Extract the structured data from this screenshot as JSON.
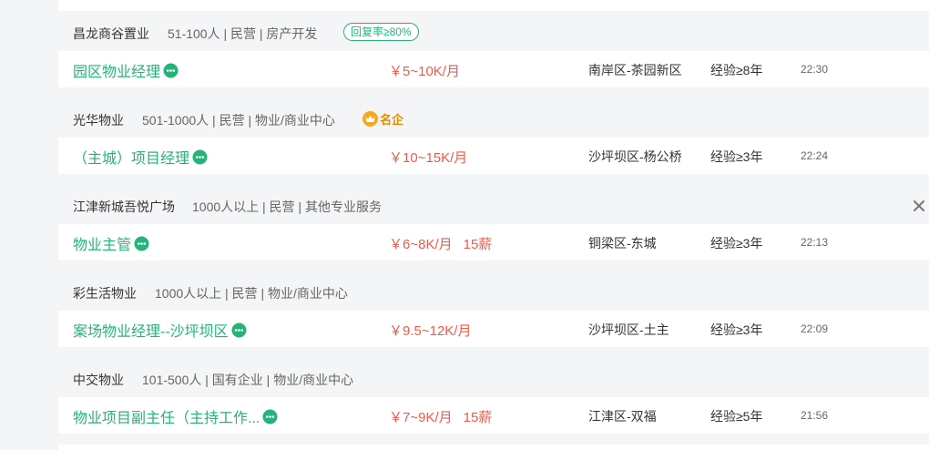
{
  "jobs": [
    {
      "company": "昌龙商谷置业",
      "info": "51-100人 | 民营 | 房产开发",
      "badge": "回复率≥80%",
      "title": "园区物业经理",
      "salary": "￥5~10K/月",
      "bonus": "",
      "location": "南岸区-茶园新区",
      "experience": "经验≥8年",
      "time": "22:30"
    },
    {
      "company": "光华物业",
      "info": "501-1000人 | 民营 | 物业/商业中心",
      "famous": "名企",
      "title": "（主城）项目经理",
      "salary": "￥10~15K/月",
      "bonus": "",
      "location": "沙坪坝区-杨公桥",
      "experience": "经验≥3年",
      "time": "22:24"
    },
    {
      "company": "江津新城吾悦广场",
      "info": "1000人以上 | 民营 | 其他专业服务",
      "title": "物业主管",
      "salary": "￥6~8K/月",
      "bonus": "15薪",
      "location": "铜梁区-东城",
      "experience": "经验≥3年",
      "time": "22:13"
    },
    {
      "company": "彩生活物业",
      "info": "1000人以上 | 民营 | 物业/商业中心",
      "title": "案场物业经理--沙坪坝区",
      "salary": "￥9.5~12K/月",
      "bonus": "",
      "location": "沙坪坝区-土主",
      "experience": "经验≥3年",
      "time": "22:09"
    },
    {
      "company": "中交物业",
      "info": "101-500人 | 国有企业 | 物业/商业中心",
      "title": "物业项目副主任（主持工作...",
      "salary": "￥7~9K/月",
      "bonus": "15薪",
      "location": "江津区-双福",
      "experience": "经验≥5年",
      "time": "21:56"
    }
  ],
  "colors": {
    "accent": "#26b37a",
    "salary": "#f05a4a",
    "famous": "#f5a623",
    "background": "#f4f5f7"
  },
  "icons": {
    "chat": "chat-bubble-icon",
    "crown": "crown-icon",
    "close": "close-icon"
  }
}
